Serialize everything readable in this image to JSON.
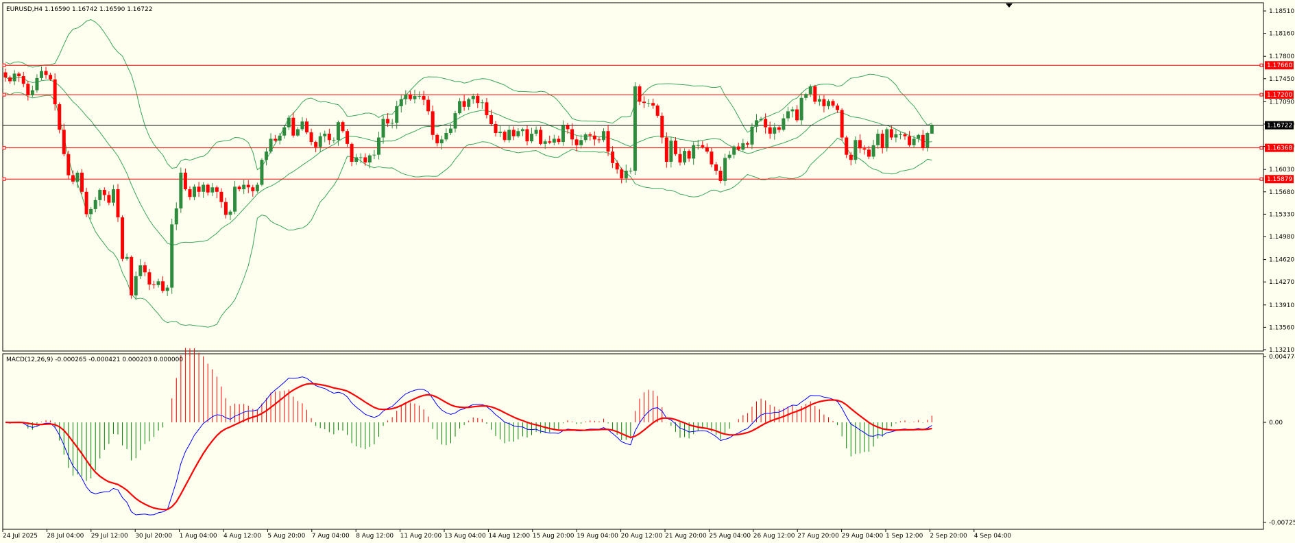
{
  "header": {
    "symbol_info": "EURUSD,H4  1.16590 1.16742 1.16590 1.16722",
    "macd_info": "MACD(12,26,9) -0.000265 -0.000421 0.000203 0.000000"
  },
  "colors": {
    "background": "#fffff0",
    "bull": "#2e8b3e",
    "bear": "#ff0000",
    "bands": "#3aa55a",
    "level_line": "#ff0000",
    "price_line": "#000000",
    "macd_line": "#0000ff",
    "signal_line": "#ff0000",
    "hist_pos": "#ff0000",
    "hist_neg": "#008000"
  },
  "chart_data": [
    {
      "type": "candlestick",
      "symbol": "EURUSD",
      "timeframe": "H4",
      "last": {
        "open": 1.1659,
        "high": 1.16742,
        "low": 1.1659,
        "close": 1.16722
      },
      "y_ticks": [
        "1.18510",
        "1.18160",
        "1.17800",
        "1.17450",
        "1.17090",
        "1.16740",
        "1.16390",
        "1.16030",
        "1.15680",
        "1.15330",
        "1.14980",
        "1.14620",
        "1.14270",
        "1.13910",
        "1.13560",
        "1.13210"
      ],
      "ylim": [
        1.1321,
        1.1851
      ],
      "levels": [
        {
          "label": "1.17660",
          "value": 1.1766
        },
        {
          "label": "1.17200",
          "value": 1.172
        },
        {
          "label": "1.16368",
          "value": 1.16368
        },
        {
          "label": "1.15879",
          "value": 1.15879
        }
      ],
      "current_price": {
        "label": "1.16722",
        "value": 1.16722
      },
      "x_labels": [
        "24 Jul 2025",
        "28 Jul 04:00",
        "29 Jul 12:00",
        "30 Jul 20:00",
        "1 Aug 04:00",
        "4 Aug 12:00",
        "5 Aug 20:00",
        "7 Aug 04:00",
        "8 Aug 12:00",
        "11 Aug 20:00",
        "13 Aug 04:00",
        "14 Aug 12:00",
        "15 Aug 20:00",
        "19 Aug 04:00",
        "20 Aug 12:00",
        "21 Aug 20:00",
        "25 Aug 04:00",
        "26 Aug 12:00",
        "27 Aug 20:00",
        "29 Aug 04:00",
        "1 Sep 12:00",
        "2 Sep 20:00",
        "4 Sep 04:00"
      ],
      "closes": [
        1.1747,
        1.1741,
        1.1753,
        1.1749,
        1.1737,
        1.1719,
        1.1727,
        1.1746,
        1.1757,
        1.1751,
        1.1744,
        1.1705,
        1.1665,
        1.1627,
        1.1594,
        1.1584,
        1.1598,
        1.1568,
        1.1533,
        1.1541,
        1.1555,
        1.1571,
        1.1563,
        1.1551,
        1.1572,
        1.1528,
        1.1463,
        1.1466,
        1.1406,
        1.1436,
        1.1453,
        1.1442,
        1.1423,
        1.1422,
        1.1428,
        1.1413,
        1.1418,
        1.1517,
        1.1542,
        1.1598,
        1.1572,
        1.156,
        1.1576,
        1.1568,
        1.1579,
        1.1567,
        1.1575,
        1.1568,
        1.1552,
        1.1532,
        1.1537,
        1.1576,
        1.1572,
        1.1579,
        1.1575,
        1.1569,
        1.1579,
        1.1618,
        1.1631,
        1.1651,
        1.1648,
        1.1656,
        1.1669,
        1.1684,
        1.1656,
        1.1666,
        1.1678,
        1.1661,
        1.1646,
        1.1638,
        1.1655,
        1.1659,
        1.1649,
        1.1649,
        1.1677,
        1.1663,
        1.1643,
        1.1615,
        1.1622,
        1.1622,
        1.1614,
        1.1625,
        1.1626,
        1.1653,
        1.1682,
        1.1675,
        1.1676,
        1.1702,
        1.1713,
        1.172,
        1.1713,
        1.1718,
        1.1718,
        1.1712,
        1.1694,
        1.1657,
        1.1644,
        1.165,
        1.166,
        1.1667,
        1.1691,
        1.171,
        1.1701,
        1.1713,
        1.1718,
        1.1707,
        1.1708,
        1.1688,
        1.1674,
        1.166,
        1.1662,
        1.1649,
        1.1665,
        1.1655,
        1.1663,
        1.1666,
        1.1647,
        1.1659,
        1.1665,
        1.1643,
        1.1647,
        1.1645,
        1.1651,
        1.1646,
        1.1672,
        1.1666,
        1.165,
        1.1641,
        1.1649,
        1.1658,
        1.1656,
        1.165,
        1.1649,
        1.1663,
        1.1631,
        1.1613,
        1.1603,
        1.1589,
        1.1601,
        1.1601,
        1.1733,
        1.1709,
        1.1707,
        1.1707,
        1.1703,
        1.1687,
        1.1653,
        1.1615,
        1.1648,
        1.1627,
        1.1614,
        1.1632,
        1.162,
        1.1641,
        1.1641,
        1.1638,
        1.1631,
        1.1611,
        1.1601,
        1.1585,
        1.1621,
        1.1626,
        1.1639,
        1.1634,
        1.1644,
        1.1642,
        1.167,
        1.168,
        1.1682,
        1.1669,
        1.1659,
        1.1669,
        1.1665,
        1.1683,
        1.1694,
        1.1697,
        1.168,
        1.1715,
        1.1721,
        1.1733,
        1.1709,
        1.1713,
        1.1702,
        1.171,
        1.1703,
        1.1696,
        1.1653,
        1.1626,
        1.1618,
        1.1649,
        1.1636,
        1.1634,
        1.1623,
        1.1641,
        1.1659,
        1.1637,
        1.1666,
        1.1653,
        1.1658,
        1.1658,
        1.1655,
        1.1641,
        1.1651,
        1.1657,
        1.1637,
        1.166,
        1.1672
      ]
    },
    {
      "type": "line+histogram",
      "indicator": "MACD(12,26,9)",
      "values": {
        "macd": -0.000265,
        "signal": -0.000421,
        "histogram": 0.000203,
        "extra": 0.0
      },
      "y_ticks": [
        "0.004774",
        "0.00",
        "-0.007257"
      ],
      "ylim": [
        -0.007257,
        0.004774
      ]
    }
  ]
}
